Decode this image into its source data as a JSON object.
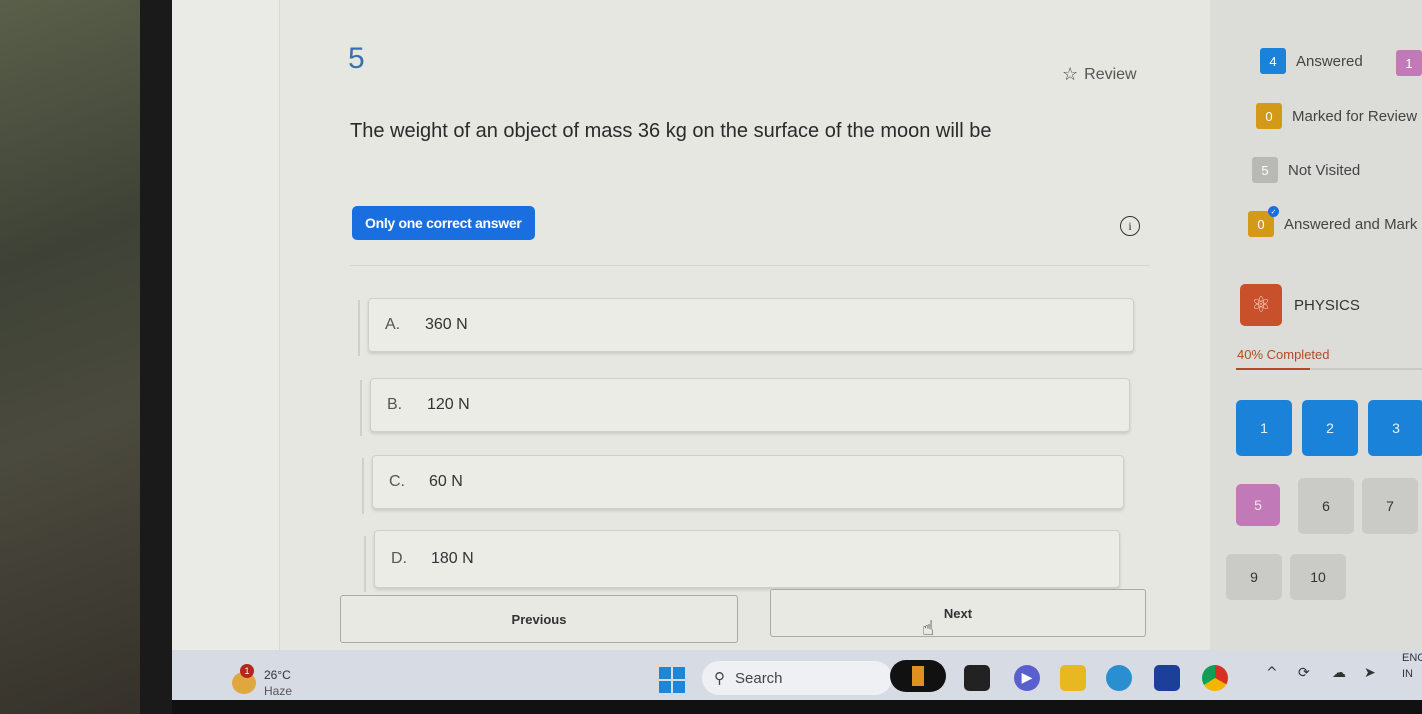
{
  "question": {
    "number": "5",
    "review_label": "Review",
    "text": "The weight of an object of mass 36 kg on the surface of the moon will be",
    "type_badge": "Only one correct answer",
    "info_icon": "info-circle-icon",
    "options": [
      {
        "letter": "A.",
        "text": "360 N"
      },
      {
        "letter": "B.",
        "text": "120 N"
      },
      {
        "letter": "C.",
        "text": "60 N"
      },
      {
        "letter": "D.",
        "text": "180 N"
      }
    ],
    "previous_label": "Previous",
    "next_label": "Next"
  },
  "legend": {
    "answered": {
      "count": "4",
      "label": "Answered",
      "color": "#1a82d8"
    },
    "not_answered": {
      "count": "1",
      "color": "#c279b8"
    },
    "marked": {
      "count": "0",
      "label": "Marked for Review",
      "color": "#d29a16"
    },
    "not_visited": {
      "count": "5",
      "label": "Not Visited",
      "color": "#b8b9b4"
    },
    "answered_marked": {
      "count": "0",
      "label": "Answered and Mark",
      "color": "#d29a16"
    }
  },
  "subject": {
    "icon": "atom-icon",
    "name": "PHYSICS",
    "progress_label": "40% Completed",
    "progress_percent": 40,
    "accent": "#b34a26"
  },
  "question_palette": [
    {
      "n": "1",
      "state": "answered"
    },
    {
      "n": "2",
      "state": "answered"
    },
    {
      "n": "3",
      "state": "answered"
    },
    {
      "n": "5",
      "state": "current"
    },
    {
      "n": "6",
      "state": "unvisited"
    },
    {
      "n": "7",
      "state": "unvisited"
    },
    {
      "n": "9",
      "state": "unvisited"
    },
    {
      "n": "10",
      "state": "unvisited"
    }
  ],
  "taskbar": {
    "weather_temp": "26°C",
    "weather_desc": "Haze",
    "weather_badge": "1",
    "search_label": "Search",
    "lang_top": "ENG",
    "lang_bottom": "IN"
  }
}
